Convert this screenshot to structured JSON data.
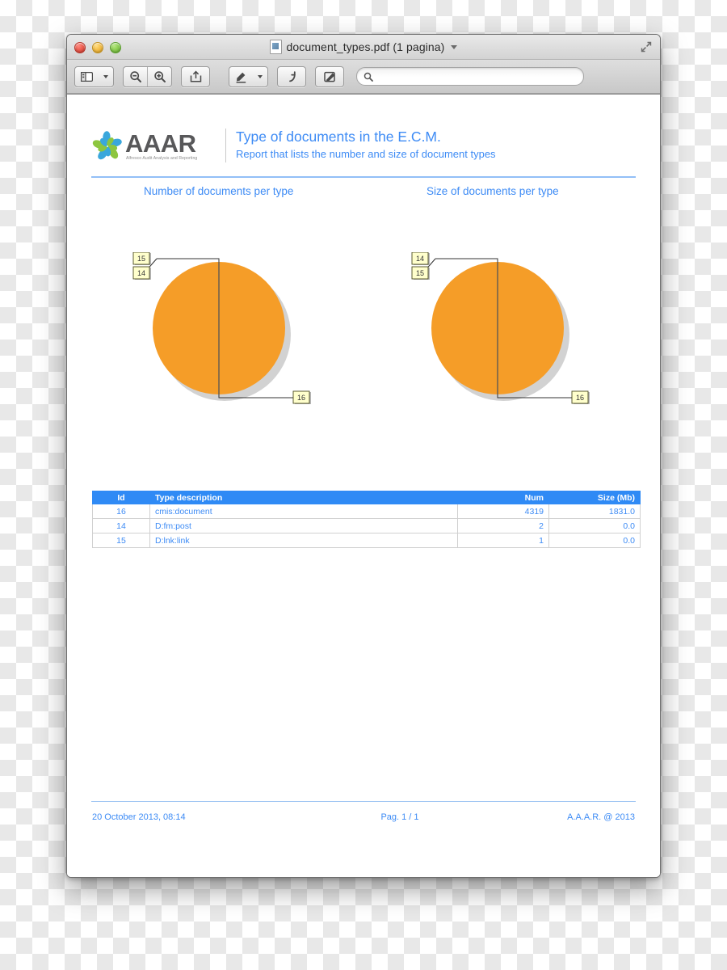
{
  "window": {
    "title": "document_types.pdf (1 pagina)",
    "title_caret": "▾",
    "traffic_lights": [
      "close",
      "minimize",
      "zoom"
    ],
    "fullscreen_icon": "fullscreen-icon"
  },
  "toolbar": {
    "items": [
      {
        "name": "sidebar-toggle-button",
        "icon": "sidebar-icon"
      },
      {
        "name": "sidebar-options-button",
        "icon": "chevron-down-icon"
      },
      {
        "name": "zoom-out-button",
        "icon": "zoom-out-icon"
      },
      {
        "name": "zoom-in-button",
        "icon": "zoom-in-icon"
      },
      {
        "name": "share-button",
        "icon": "share-icon"
      },
      {
        "name": "highlight-button",
        "icon": "highlighter-icon"
      },
      {
        "name": "highlight-options-button",
        "icon": "chevron-down-icon"
      },
      {
        "name": "rotate-button",
        "icon": "rotate-left-icon"
      },
      {
        "name": "markup-button",
        "icon": "markup-pen-icon"
      }
    ],
    "search": {
      "placeholder": "",
      "value": "",
      "icon": "search-icon"
    }
  },
  "report": {
    "logo": {
      "word": "AAAR",
      "tagline": "Alfresco Audit Analysis and Reporting",
      "mark": "pinwheel-flower-logo"
    },
    "title": "Type of documents in the E.C.M.",
    "subtitle": "Report that lists the number and size of document types",
    "chart_titles": {
      "left": "Number of documents per type",
      "right": "Size of documents per type"
    },
    "table": {
      "headers": [
        "Id",
        "Type description",
        "Num",
        "Size (Mb)"
      ],
      "rows": [
        {
          "id": "16",
          "desc": "cmis:document",
          "num": "4319",
          "size": "1831.0"
        },
        {
          "id": "14",
          "desc": "D:fm:post",
          "num": "2",
          "size": "0.0"
        },
        {
          "id": "15",
          "desc": "D:lnk:link",
          "num": "1",
          "size": "0.0"
        }
      ]
    },
    "footer": {
      "date": "20 October 2013, 08:14",
      "page": "Pag. 1 / 1",
      "copyright": "A.A.A.R. @ 2013"
    },
    "colors": {
      "accent_blue": "#3d8bf5",
      "table_header_blue": "#2f8af5",
      "pie_orange": "#f59d28",
      "label_yellow": "#ffffcc"
    }
  },
  "chart_data": [
    {
      "type": "pie",
      "title": "Number of documents per type",
      "categories": [
        "16",
        "14",
        "15"
      ],
      "labels": [
        "cmis:document",
        "D:fm:post",
        "D:lnk:link"
      ],
      "values": [
        4319,
        2,
        1
      ],
      "unit": "documents",
      "colors": [
        "#f59d28",
        "#f59d28",
        "#f59d28"
      ],
      "callouts": [
        {
          "label": "15",
          "position": "top-left"
        },
        {
          "label": "14",
          "position": "top-left"
        },
        {
          "label": "16",
          "position": "bottom-right"
        }
      ],
      "legend": "callout-labels"
    },
    {
      "type": "pie",
      "title": "Size of documents per type",
      "categories": [
        "16",
        "14",
        "15"
      ],
      "labels": [
        "cmis:document",
        "D:fm:post",
        "D:lnk:link"
      ],
      "values": [
        1831.0,
        0.0,
        0.0
      ],
      "unit": "Mb",
      "colors": [
        "#f59d28",
        "#f59d28",
        "#f59d28"
      ],
      "callouts": [
        {
          "label": "14",
          "position": "top-left"
        },
        {
          "label": "15",
          "position": "top-left"
        },
        {
          "label": "16",
          "position": "bottom-right"
        }
      ],
      "legend": "callout-labels"
    }
  ]
}
